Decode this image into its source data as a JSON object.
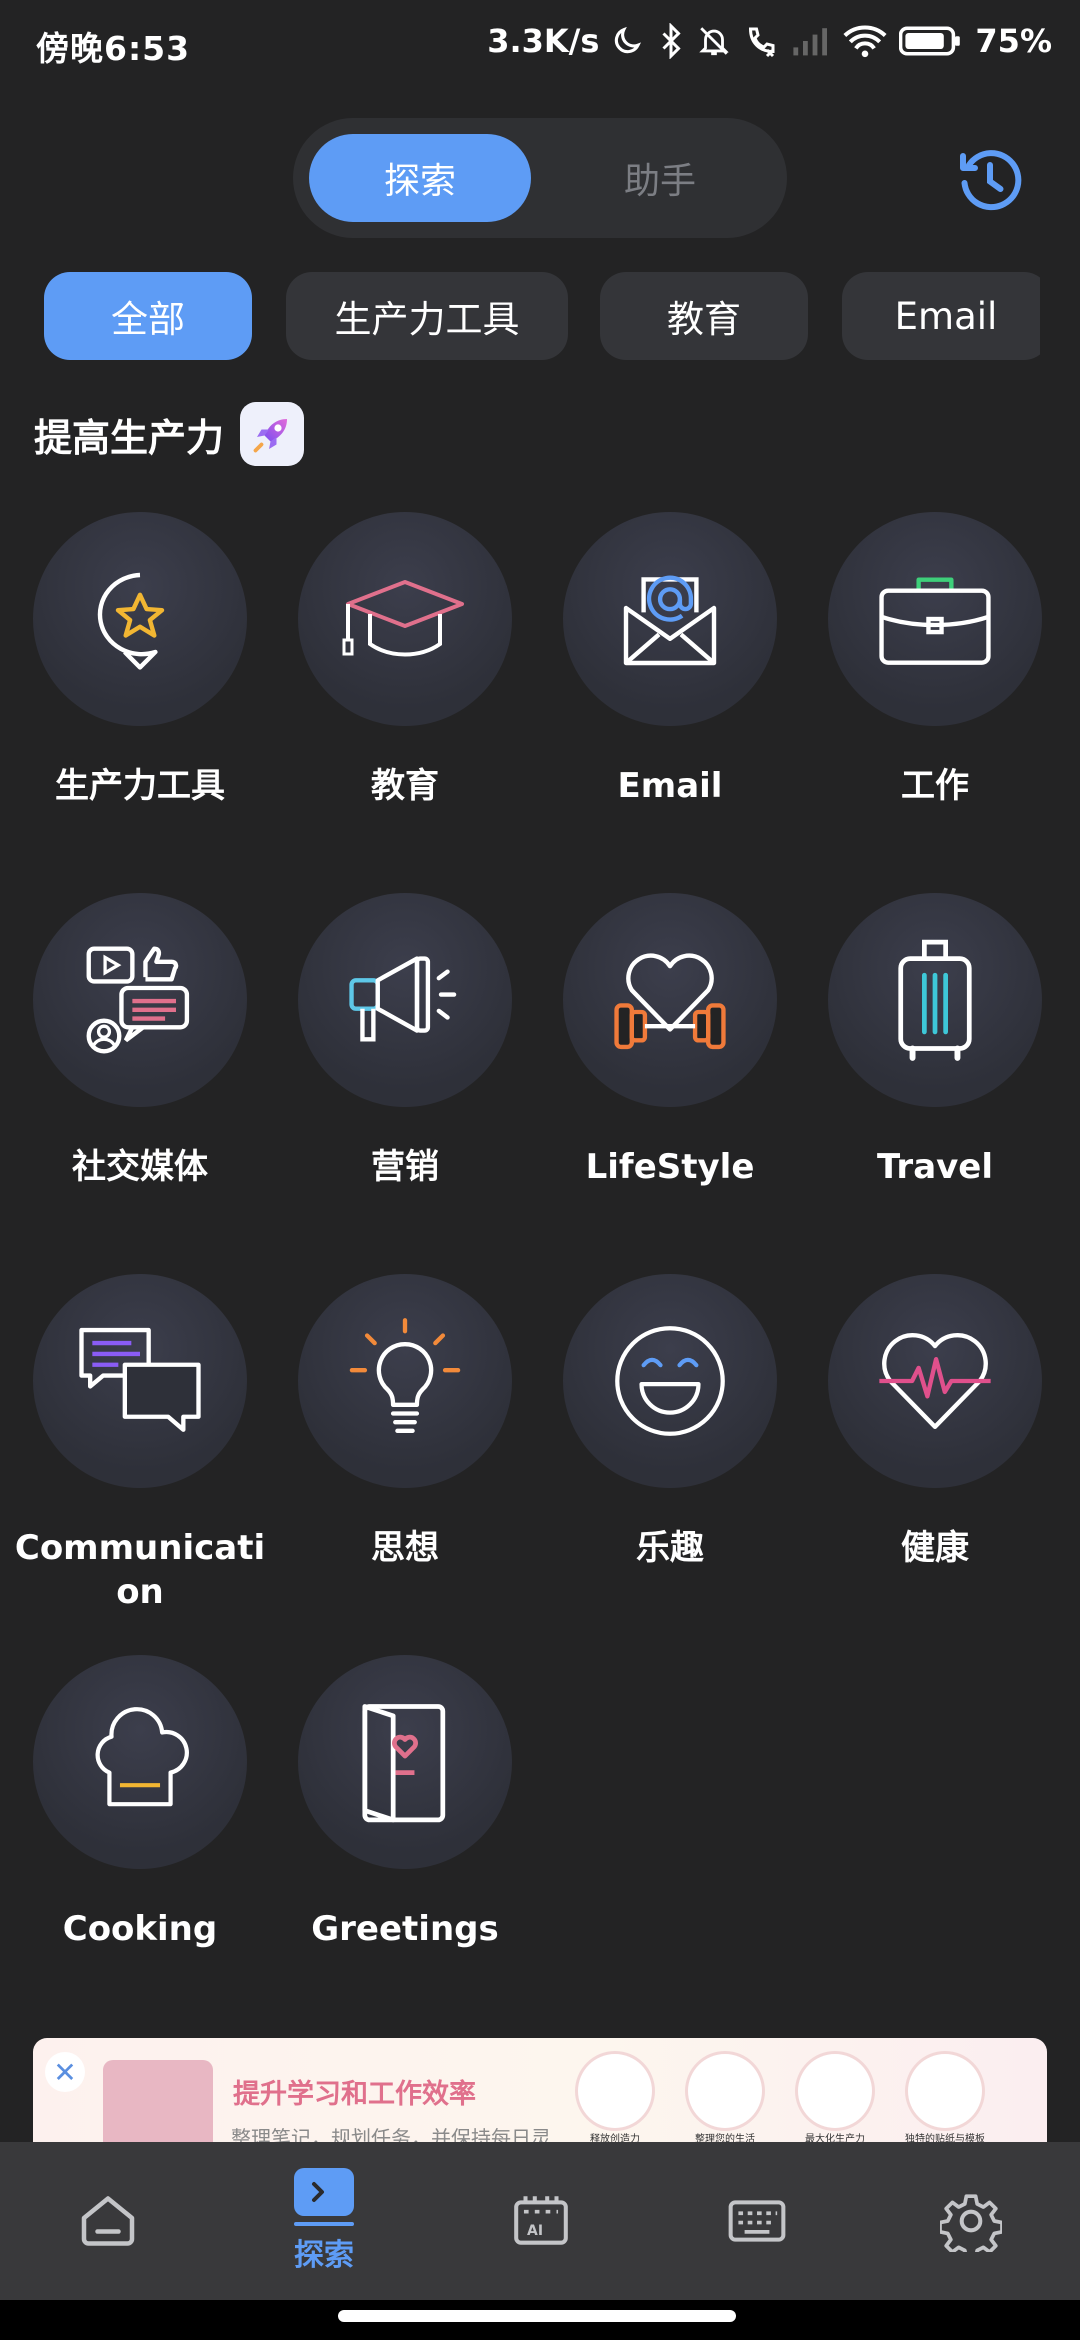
{
  "status_bar": {
    "time": "傍晚6:53",
    "network_speed": "3.3K/s",
    "battery": "75%"
  },
  "mode_toggle": {
    "active": "探索",
    "inactive": "助手"
  },
  "filters": [
    {
      "label": "全部",
      "active": true
    },
    {
      "label": "生产力工具",
      "active": false
    },
    {
      "label": "教育",
      "active": false
    },
    {
      "label": "Email",
      "active": false
    }
  ],
  "section": {
    "title": "提高生产力"
  },
  "categories": [
    {
      "label": "生产力工具",
      "icon": "star-speech-bubble-icon"
    },
    {
      "label": "教育",
      "icon": "graduation-cap-icon"
    },
    {
      "label": "Email",
      "icon": "email-envelope-icon"
    },
    {
      "label": "工作",
      "icon": "briefcase-icon"
    },
    {
      "label": "社交媒体",
      "icon": "social-media-icon"
    },
    {
      "label": "营销",
      "icon": "megaphone-icon"
    },
    {
      "label": "LifeStyle",
      "icon": "heart-dumbbell-icon"
    },
    {
      "label": "Travel",
      "icon": "suitcase-icon"
    },
    {
      "label": "Communication",
      "icon": "chat-bubbles-icon"
    },
    {
      "label": "思想",
      "icon": "lightbulb-icon"
    },
    {
      "label": "乐趣",
      "icon": "smiley-face-icon"
    },
    {
      "label": "健康",
      "icon": "heartbeat-icon"
    },
    {
      "label": "Cooking",
      "icon": "chef-hat-icon"
    },
    {
      "label": "Greetings",
      "icon": "greeting-card-icon"
    }
  ],
  "promo": {
    "title": "提升学习和工作效率",
    "subtitle": "整理笔记，规划任务，并保持每日灵",
    "features": [
      "释放创造力",
      "整理您的生活",
      "最大化生产力",
      "独特的贴纸与模板"
    ]
  },
  "bottom_nav": {
    "explore_label": "探索"
  },
  "colors": {
    "accent": "#5e9cf5",
    "background": "#232324",
    "chip": "#343539"
  }
}
